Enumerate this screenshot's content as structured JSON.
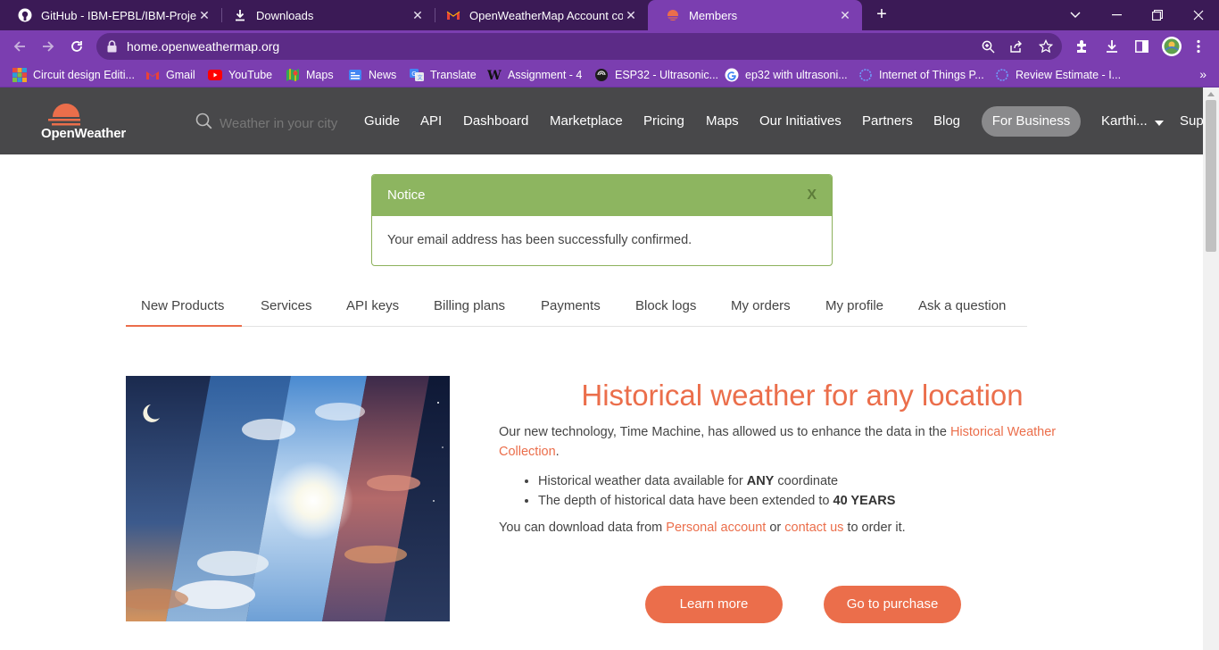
{
  "browser": {
    "tabs": [
      {
        "title": "GitHub - IBM-EPBL/IBM-Project-",
        "icon": "github-icon"
      },
      {
        "title": "Downloads",
        "icon": "download-icon"
      },
      {
        "title": "OpenWeatherMap Account confi",
        "icon": "gmail-icon"
      },
      {
        "title": "Members",
        "icon": "openweather-icon",
        "active": true
      }
    ],
    "url": "home.openweathermap.org",
    "bookmarks": [
      {
        "label": "Circuit design Editi...",
        "icon": "tinkercad-icon"
      },
      {
        "label": "Gmail",
        "icon": "gmail-icon"
      },
      {
        "label": "YouTube",
        "icon": "youtube-icon"
      },
      {
        "label": "Maps",
        "icon": "maps-icon"
      },
      {
        "label": "News",
        "icon": "news-icon"
      },
      {
        "label": "Translate",
        "icon": "translate-icon"
      },
      {
        "label": "Assignment - 4",
        "icon": "wordpress-icon"
      },
      {
        "label": "ESP32 - Ultrasonic...",
        "icon": "esp32-icon"
      },
      {
        "label": "ep32 with ultrasoni...",
        "icon": "google-icon"
      },
      {
        "label": "Internet of Things P...",
        "icon": "ibm-icon"
      },
      {
        "label": "Review Estimate - I...",
        "icon": "ibm-icon"
      }
    ],
    "bookmarks_more": "»"
  },
  "header": {
    "logo_text": "OpenWeather",
    "search_placeholder": "Weather in your city",
    "nav": [
      "Guide",
      "API",
      "Dashboard",
      "Marketplace",
      "Pricing",
      "Maps",
      "Our Initiatives",
      "Partners",
      "Blog"
    ],
    "for_business": "For Business",
    "user": "Karthi...",
    "support": "Sup"
  },
  "notice": {
    "title": "Notice",
    "close": "X",
    "message": "Your email address has been successfully confirmed."
  },
  "page_tabs": [
    "New Products",
    "Services",
    "API keys",
    "Billing plans",
    "Payments",
    "Block logs",
    "My orders",
    "My profile",
    "Ask a question"
  ],
  "hero": {
    "title": "Historical weather for any location",
    "para_before": "Our new technology, Time Machine, has allowed us to enhance the data in the ",
    "para_link": "Historical Weather Collection",
    "para_after": ".",
    "bullet1_before": "Historical weather data available for ",
    "bullet1_bold": "ANY",
    "bullet1_after": " coordinate",
    "bullet2_before": "The depth of historical data have been extended to ",
    "bullet2_bold": "40 YEARS",
    "download_before": "You can download data from ",
    "download_link1": "Personal account",
    "download_mid": " or ",
    "download_link2": "contact us",
    "download_after": " to order it.",
    "learn_more": "Learn more",
    "purchase": "Go to purchase"
  },
  "colors": {
    "accent": "#eb6e4b",
    "header_bg": "#48484a",
    "notice_green": "#8db560",
    "browser_purple": "#7b3eb0"
  }
}
